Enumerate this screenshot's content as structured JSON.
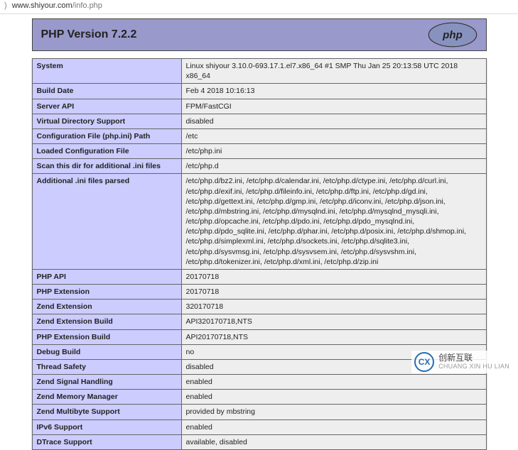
{
  "address_bar": {
    "prefix_glyph": ")",
    "host": "www.shiyour.com",
    "path": "/info.php"
  },
  "header": {
    "title": "PHP Version 7.2.2",
    "logo_text": "php"
  },
  "rows": [
    {
      "k": "System",
      "v": "Linux shiyour 3.10.0-693.17.1.el7.x86_64 #1 SMP Thu Jan 25 20:13:58 UTC 2018 x86_64"
    },
    {
      "k": "Build Date",
      "v": "Feb 4 2018 10:16:13"
    },
    {
      "k": "Server API",
      "v": "FPM/FastCGI"
    },
    {
      "k": "Virtual Directory Support",
      "v": "disabled"
    },
    {
      "k": "Configuration File (php.ini) Path",
      "v": "/etc"
    },
    {
      "k": "Loaded Configuration File",
      "v": "/etc/php.ini"
    },
    {
      "k": "Scan this dir for additional .ini files",
      "v": "/etc/php.d"
    },
    {
      "k": "Additional .ini files parsed",
      "v": "/etc/php.d/bz2.ini, /etc/php.d/calendar.ini, /etc/php.d/ctype.ini, /etc/php.d/curl.ini, /etc/php.d/exif.ini, /etc/php.d/fileinfo.ini, /etc/php.d/ftp.ini, /etc/php.d/gd.ini, /etc/php.d/gettext.ini, /etc/php.d/gmp.ini, /etc/php.d/iconv.ini, /etc/php.d/json.ini, /etc/php.d/mbstring.ini, /etc/php.d/mysqlnd.ini, /etc/php.d/mysqlnd_mysqli.ini, /etc/php.d/opcache.ini, /etc/php.d/pdo.ini, /etc/php.d/pdo_mysqlnd.ini, /etc/php.d/pdo_sqlite.ini, /etc/php.d/phar.ini, /etc/php.d/posix.ini, /etc/php.d/shmop.ini, /etc/php.d/simplexml.ini, /etc/php.d/sockets.ini, /etc/php.d/sqlite3.ini, /etc/php.d/sysvmsg.ini, /etc/php.d/sysvsem.ini, /etc/php.d/sysvshm.ini, /etc/php.d/tokenizer.ini, /etc/php.d/xml.ini, /etc/php.d/zip.ini"
    },
    {
      "k": "PHP API",
      "v": "20170718"
    },
    {
      "k": "PHP Extension",
      "v": "20170718"
    },
    {
      "k": "Zend Extension",
      "v": "320170718"
    },
    {
      "k": "Zend Extension Build",
      "v": "API320170718,NTS"
    },
    {
      "k": "PHP Extension Build",
      "v": "API20170718,NTS"
    },
    {
      "k": "Debug Build",
      "v": "no"
    },
    {
      "k": "Thread Safety",
      "v": "disabled"
    },
    {
      "k": "Zend Signal Handling",
      "v": "enabled"
    },
    {
      "k": "Zend Memory Manager",
      "v": "enabled"
    },
    {
      "k": "Zend Multibyte Support",
      "v": "provided by mbstring"
    },
    {
      "k": "IPv6 Support",
      "v": "enabled"
    },
    {
      "k": "DTrace Support",
      "v": "available, disabled"
    }
  ],
  "watermark": {
    "logo_letters": "CX",
    "line1": "创新互联",
    "line2": "CHUANG XIN HU LIAN"
  }
}
